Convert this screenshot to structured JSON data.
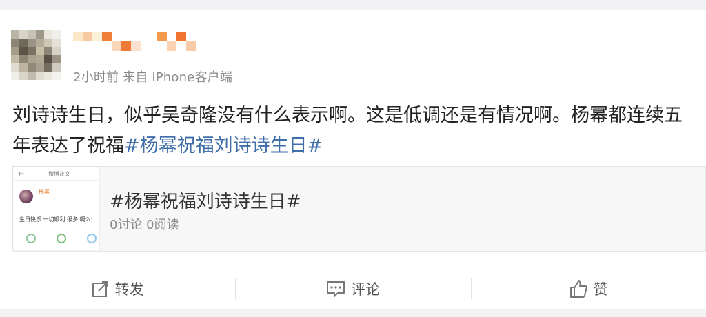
{
  "post": {
    "meta": "2小时前 来自 iPhone客户端",
    "text": "刘诗诗生日，似乎吴奇隆没有什么表示啊。这是低调还是有情况啊。杨幂都连续五年表达了祝福",
    "hashtag": "#杨幂祝福刘诗诗生日#"
  },
  "link_card": {
    "title": "#杨幂祝福刘诗诗生日#",
    "stats": "0讨论 0阅读",
    "thumbnail": {
      "header": "微博正文",
      "author": "杨幂",
      "body": "生日快乐 一切顺利 很多 啊么!"
    }
  },
  "actions": {
    "repost": "转发",
    "comment": "评论",
    "like": "赞"
  },
  "icons": {
    "repost": "repost-icon",
    "comment": "comment-icon",
    "like": "like-icon"
  },
  "colors": {
    "hashtag": "#3f6ea8",
    "meta": "#8a8a8a"
  }
}
